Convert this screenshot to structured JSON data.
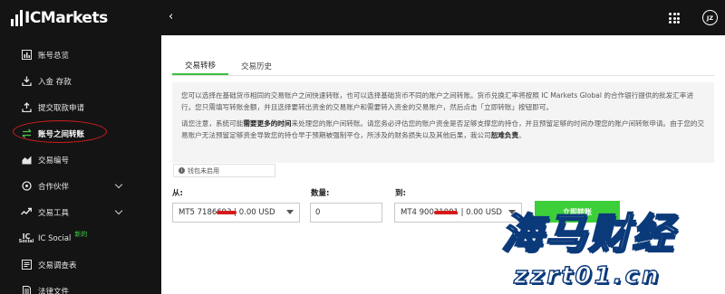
{
  "brand": {
    "name": "ICMarkets"
  },
  "sidebar": {
    "items": [
      {
        "label": "账号总览",
        "icon": "overview-icon"
      },
      {
        "label": "入金 存款",
        "icon": "deposit-icon"
      },
      {
        "label": "提交取款申请",
        "icon": "withdraw-icon"
      },
      {
        "label": "账号之间转账",
        "icon": "transfer-icon",
        "active": true
      },
      {
        "label": "交易编号",
        "icon": "trade-id-icon"
      },
      {
        "label": "合作伙伴",
        "icon": "partner-icon",
        "has_submenu": true
      },
      {
        "label": "交易工具",
        "icon": "tools-icon",
        "has_submenu": true
      },
      {
        "label": "IC Social",
        "icon": "ic-social-icon",
        "icon_text": "IC",
        "icon_sub": "Social",
        "badge": "新的"
      },
      {
        "label": "交易调查表",
        "icon": "survey-icon"
      },
      {
        "label": "法律文件",
        "icon": "legal-icon"
      }
    ]
  },
  "topbar": {
    "back_symbol": "‹",
    "avatar_initials": "JZ"
  },
  "tabs": [
    {
      "label": "交易转移",
      "active": true
    },
    {
      "label": "交易历史",
      "active": false
    }
  ],
  "info": {
    "para1": "您可以选择在基础货币相同的交易账户之间快速转账，也可以选择基础货币不同的账户之间转账。货币兑换汇率将按照 IC Markets Global 的合作银行提供的批发汇率进行。您只需填写转账金额，并且选择要转出资金的交易账户和需要转入资金的交易账户，然后点击「立即转账」按钮即可。",
    "para2_prefix": "请您注意，系统可能",
    "para2_bold1": "需要更多的时间",
    "para2_mid": "来处理您的账户间转账。请您务必评估您的账户资金是否足够支撑您的持仓，并且预留足够的时间办理您的账户间转账申请。由于您的交易账户无法预留足够资金导致您的持仓早于预期被强制平仓，所涉及的财务损失以及其他后果，我公司",
    "para2_bold2": "恕难负责",
    "para2_suffix": "。"
  },
  "wallet_status": {
    "icon": "info-icon",
    "text": "钱包未启用"
  },
  "form": {
    "from_label": "从:",
    "from_value": "MT5 7186693 | 0.00 USD",
    "amount_label": "数量:",
    "amount_value": "0",
    "to_label": "到:",
    "to_value": "MT4 90031001 | 0.00 USD",
    "submit_label": "立即转账"
  },
  "watermark": {
    "text": "海马财经",
    "url": "zzrt01.cn"
  }
}
